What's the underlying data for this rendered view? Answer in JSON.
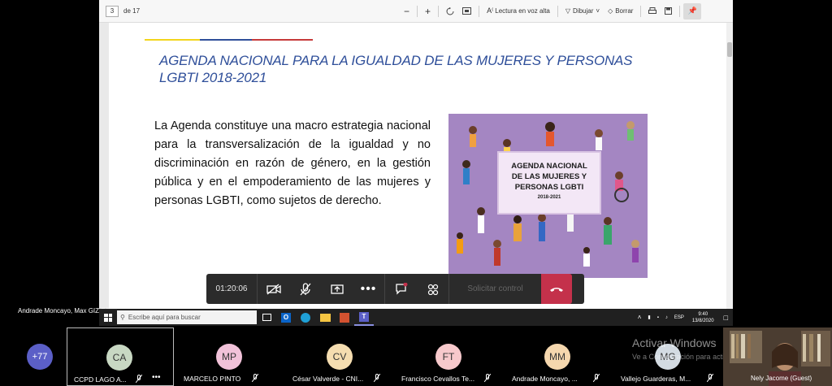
{
  "pdf_toolbar": {
    "page_current": "3",
    "page_total": "de 17",
    "zoom_out": "−",
    "zoom_in": "+",
    "read_aloud": "Lectura en voz alta",
    "draw": "Dibujar",
    "erase": "Borrar"
  },
  "slide": {
    "title_line1": "AGENDA NACIONAL PARA LA IGUALDAD DE LAS  MUJERES Y PERSONAS",
    "title_line2": "LGBTI 2018-2021",
    "body": "La Agenda constituye una macro estrategia nacional para la transversalización de la igualdad y no discriminación  en razón de género, en la gestión pública y en el empoderamiento de las  mujeres y personas LGBTI,  como sujetos de derecho.",
    "cover_line1": "AGENDA NACIONAL",
    "cover_line2": "DE LAS MUJERES Y",
    "cover_line3": "PERSONAS LGBTI",
    "cover_year": "2018-2021"
  },
  "call_bar": {
    "timer": "01:20:06",
    "request_control": "Solicitar control"
  },
  "sharer_label": "Andrade Moncayo, Max GIZ EC",
  "taskbar": {
    "search_placeholder": "Escribe aquí para buscar",
    "lang": "ESP",
    "time": "9:40",
    "date": "13/8/2020"
  },
  "participants": {
    "overflow_count": "+77",
    "tiles": [
      {
        "initials": "CA",
        "name": "CCPD LAGO A...",
        "color": "#c8d8c3"
      },
      {
        "initials": "MP",
        "name": "MARCELO PINTO",
        "color": "#f1c2d9"
      },
      {
        "initials": "CV",
        "name": "César Valverde - CNI...",
        "color": "#f5ddb0"
      },
      {
        "initials": "FT",
        "name": "Francisco Cevallos Te...",
        "color": "#f7c9cc"
      },
      {
        "initials": "MM",
        "name": "Andrade Moncayo, ...",
        "color": "#f5d7ae"
      },
      {
        "initials": "MG",
        "name": "Vallejo Guarderas, M...",
        "color": "#d3dbe2"
      }
    ],
    "video_name": "Nely Jacome (Guest)"
  },
  "watermark": {
    "title": "Activar Windows",
    "subtitle": "Ve a Configuración para activar Windows."
  },
  "colors": {
    "title_blue": "#2f4f9a",
    "cover_purple": "#a486c2",
    "hangup_red": "#c4314b",
    "teams_purple": "#5b5fc7"
  }
}
